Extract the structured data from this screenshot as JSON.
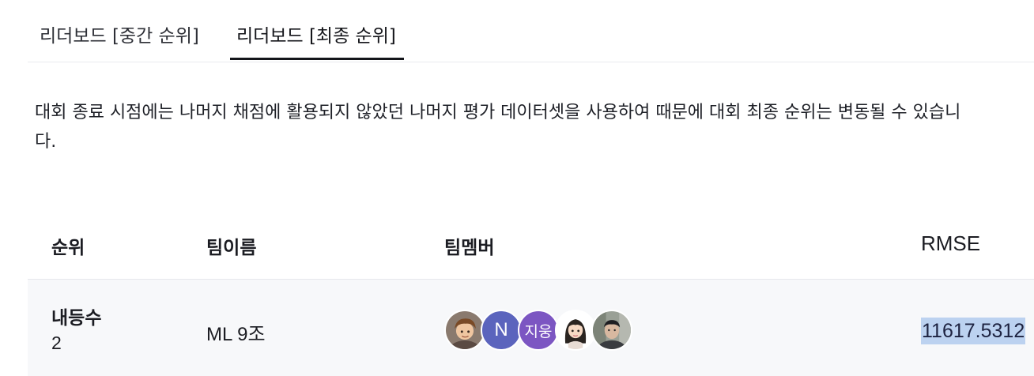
{
  "tabs": [
    {
      "label": "리더보드 [중간 순위]",
      "active": false
    },
    {
      "label": "리더보드 [최종 순위]",
      "active": true
    }
  ],
  "description": "대회 종료 시점에는 나머지 채점에 활용되지 않았던 나머지 평가 데이터셋을 사용하여 때문에 대회 최종 순위는 변동될 수 있습니다.",
  "table": {
    "headers": {
      "rank": "순위",
      "team": "팀이름",
      "members": "팀멤버",
      "rmse": "RMSE"
    },
    "rows": [
      {
        "rank_label": "내등수",
        "rank": "2",
        "team": "ML 9조",
        "members": [
          {
            "type": "photo",
            "icon": "cartoon-boy-avatar"
          },
          {
            "type": "initial",
            "text": "N",
            "color": "#5b64bd"
          },
          {
            "type": "initial",
            "text": "지웅",
            "color": "#7c56c2"
          },
          {
            "type": "photo",
            "icon": "cartoon-girl-avatar"
          },
          {
            "type": "photo",
            "icon": "man-photo-avatar"
          }
        ],
        "rmse": "11617.5312"
      }
    ]
  },
  "colors": {
    "highlight": "#bcd2f0",
    "row_background": "#f7f8fa",
    "active_tab_underline": "#14151a"
  }
}
